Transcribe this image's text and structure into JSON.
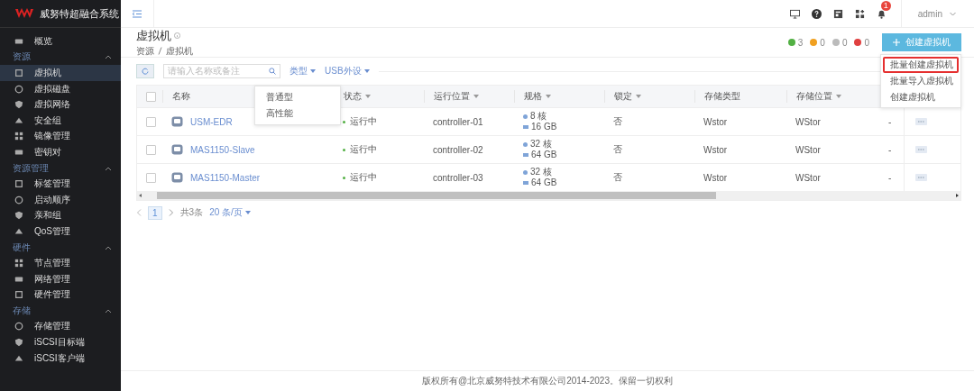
{
  "brand": {
    "title": "威努特超融合系统"
  },
  "sidebar": {
    "items": [
      {
        "label": "概览",
        "selected": false
      }
    ],
    "sections": [
      {
        "title": "资源",
        "expanded": true,
        "items": [
          {
            "label": "虚拟机",
            "selected": true
          },
          {
            "label": "虚拟磁盘",
            "selected": false
          },
          {
            "label": "虚拟网络",
            "selected": false
          },
          {
            "label": "安全组",
            "selected": false
          },
          {
            "label": "镜像管理",
            "selected": false
          },
          {
            "label": "密钥对",
            "selected": false
          }
        ]
      },
      {
        "title": "资源管理",
        "expanded": true,
        "items": [
          {
            "label": "标签管理",
            "selected": false
          },
          {
            "label": "启动顺序",
            "selected": false
          },
          {
            "label": "亲和组",
            "selected": false
          },
          {
            "label": "QoS管理",
            "selected": false
          }
        ]
      },
      {
        "title": "硬件",
        "expanded": true,
        "items": [
          {
            "label": "节点管理",
            "selected": false
          },
          {
            "label": "网络管理",
            "selected": false
          },
          {
            "label": "硬件管理",
            "selected": false
          }
        ]
      },
      {
        "title": "存储",
        "expanded": true,
        "items": [
          {
            "label": "存储管理",
            "selected": false
          },
          {
            "label": "iSCSI目标端",
            "selected": false
          },
          {
            "label": "iSCSI客户端",
            "selected": false
          }
        ]
      }
    ]
  },
  "header": {
    "notification_badge": "1",
    "user": "admin"
  },
  "page": {
    "title": "虚拟机",
    "breadcrumb": [
      "资源",
      "虚拟机"
    ]
  },
  "status_counts": [
    {
      "count": "3",
      "color": "#52b043"
    },
    {
      "count": "0",
      "color": "#f0a020"
    },
    {
      "count": "0",
      "color": "#bbbbbb"
    },
    {
      "count": "0",
      "color": "#e04040"
    }
  ],
  "create_button": "创建虚拟机",
  "create_menu": [
    {
      "label": "批量创建虚拟机",
      "highlighted": true
    },
    {
      "label": "批量导入虚拟机",
      "highlighted": false
    },
    {
      "label": "创建虚拟机",
      "highlighted": false
    }
  ],
  "toolbar": {
    "search_placeholder": "请输入名称或备注",
    "filters": [
      "类型",
      "USB外设"
    ]
  },
  "type_menu": [
    "普通型",
    "高性能"
  ],
  "table": {
    "all_checked": false,
    "columns": [
      "名称",
      "状态",
      "运行位置",
      "规格",
      "锁定",
      "存储类型",
      "存储位置"
    ],
    "rows": [
      {
        "checked": false,
        "name": "USM-EDR",
        "status": "运行中",
        "location": "controller-01",
        "cpu": "8 核",
        "memory": "16 GB",
        "locked": "否",
        "storage_type": "Wstor",
        "storage_location": "WStor",
        "column_8": "-"
      },
      {
        "checked": false,
        "name": "MAS1150-Slave",
        "status": "运行中",
        "location": "controller-02",
        "cpu": "32 核",
        "memory": "64 GB",
        "locked": "否",
        "storage_type": "Wstor",
        "storage_location": "WStor",
        "column_8": "-"
      },
      {
        "checked": false,
        "name": "MAS1150-Master",
        "status": "运行中",
        "location": "controller-03",
        "cpu": "32 核",
        "memory": "64 GB",
        "locked": "否",
        "storage_type": "Wstor",
        "storage_location": "WStor",
        "column_8": "-"
      }
    ]
  },
  "pagination": {
    "pages": [
      {
        "label": "1",
        "selected": true
      }
    ],
    "total": "共3条",
    "page_size": "20 条/页"
  },
  "footer": "版权所有@北京威努特技术有限公司2014-2023。保留一切权利"
}
